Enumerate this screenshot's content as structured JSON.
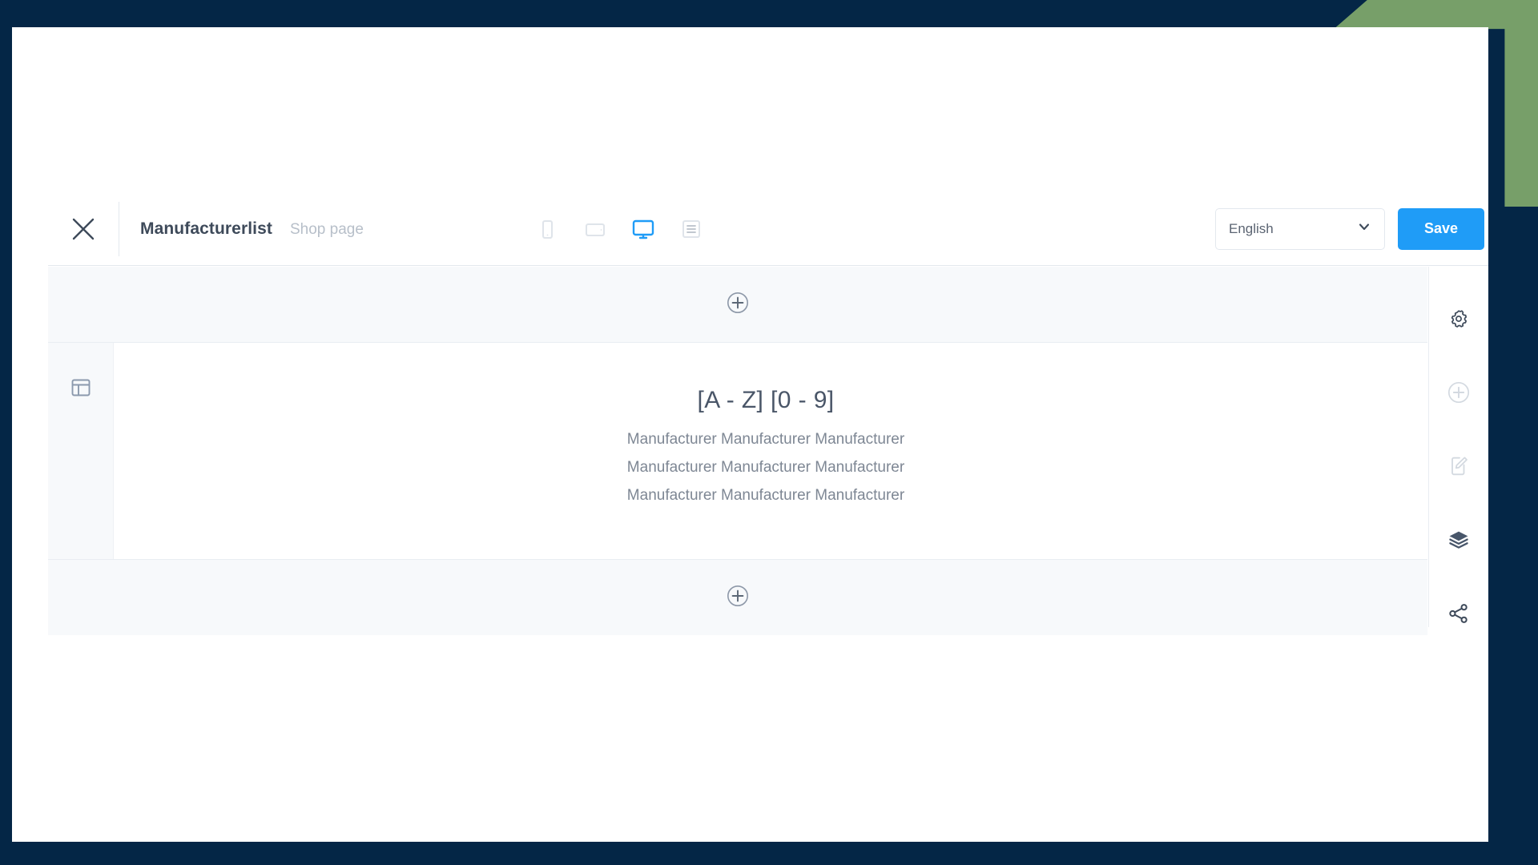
{
  "frame": {
    "border_color": "#042646",
    "accent_color": "#779f69"
  },
  "header": {
    "close_icon": "close-icon",
    "title": "Manufacturerlist",
    "subtitle": "Shop page",
    "devices": [
      {
        "name": "mobile",
        "icon": "mobile-icon",
        "active": false
      },
      {
        "name": "tablet",
        "icon": "tablet-icon",
        "active": false
      },
      {
        "name": "desktop",
        "icon": "desktop-icon",
        "active": true
      },
      {
        "name": "content",
        "icon": "list-view-icon",
        "active": false
      }
    ],
    "active_device_color": "#1f9cf7",
    "language": {
      "value": "English",
      "chevron_icon": "chevron-down-icon"
    },
    "save_label": "Save",
    "save_color": "#1f9cf7"
  },
  "stage": {
    "add_top_label": "+",
    "add_bottom_label": "+",
    "section_handle_icon": "layout-icon",
    "content": {
      "heading": "[A - Z] [0 - 9]",
      "lines": [
        "Manufacturer Manufacturer Manufacturer",
        "Manufacturer Manufacturer Manufacturer",
        "Manufacturer Manufacturer Manufacturer"
      ]
    }
  },
  "tool_rail": {
    "items": [
      {
        "name": "settings",
        "icon": "gear-icon",
        "enabled": true
      },
      {
        "name": "add-element",
        "icon": "plus-circle-icon",
        "enabled": false
      },
      {
        "name": "edit-content",
        "icon": "document-edit-icon",
        "enabled": false
      },
      {
        "name": "layers",
        "icon": "layers-icon",
        "enabled": true
      },
      {
        "name": "share",
        "icon": "share-icon",
        "enabled": true
      }
    ]
  }
}
